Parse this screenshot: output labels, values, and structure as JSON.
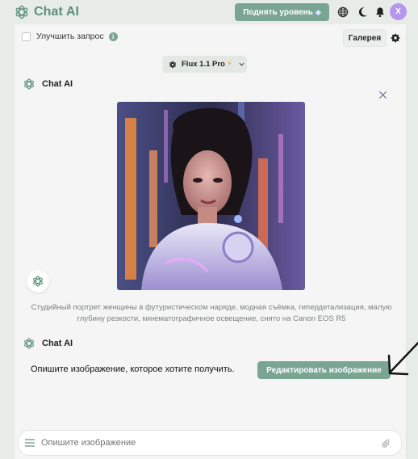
{
  "app": {
    "name": "Chat AI"
  },
  "header": {
    "upgrade_label": "Поднять уровень",
    "avatar_initial": "X"
  },
  "toolbar": {
    "enhance_label": "Улучшить запрос",
    "enhance_checked": false,
    "gallery_label": "Галерея"
  },
  "model": {
    "selected": "Flux 1.1 Pro"
  },
  "messages": [
    {
      "sender": "Chat AI",
      "caption": "Студийный портрет женщины в футуристическом наряде, модная съёмка, гипердетализация, малую глубину резкости, кинематографичное освещение, снято на Canon EOS R5"
    },
    {
      "sender": "Chat AI",
      "text": "Опишите изображение, которое хотите получить.",
      "action_label": "Редактировать изображение"
    }
  ],
  "composer": {
    "placeholder": "Опишите изображение",
    "value": ""
  },
  "icons": {
    "logo": "openai-knot-icon",
    "globe": "globe-icon",
    "theme": "moon-icon",
    "notifications": "bell-icon",
    "settings": "gear-icon",
    "close": "close-icon",
    "menu": "hamburger-icon",
    "attach": "paperclip-icon"
  },
  "colors": {
    "accent": "#7aa593",
    "logo_text": "#5e8f78",
    "avatar": "#b697ee",
    "background": "#e8ece9",
    "panel": "#f4f5f4"
  }
}
